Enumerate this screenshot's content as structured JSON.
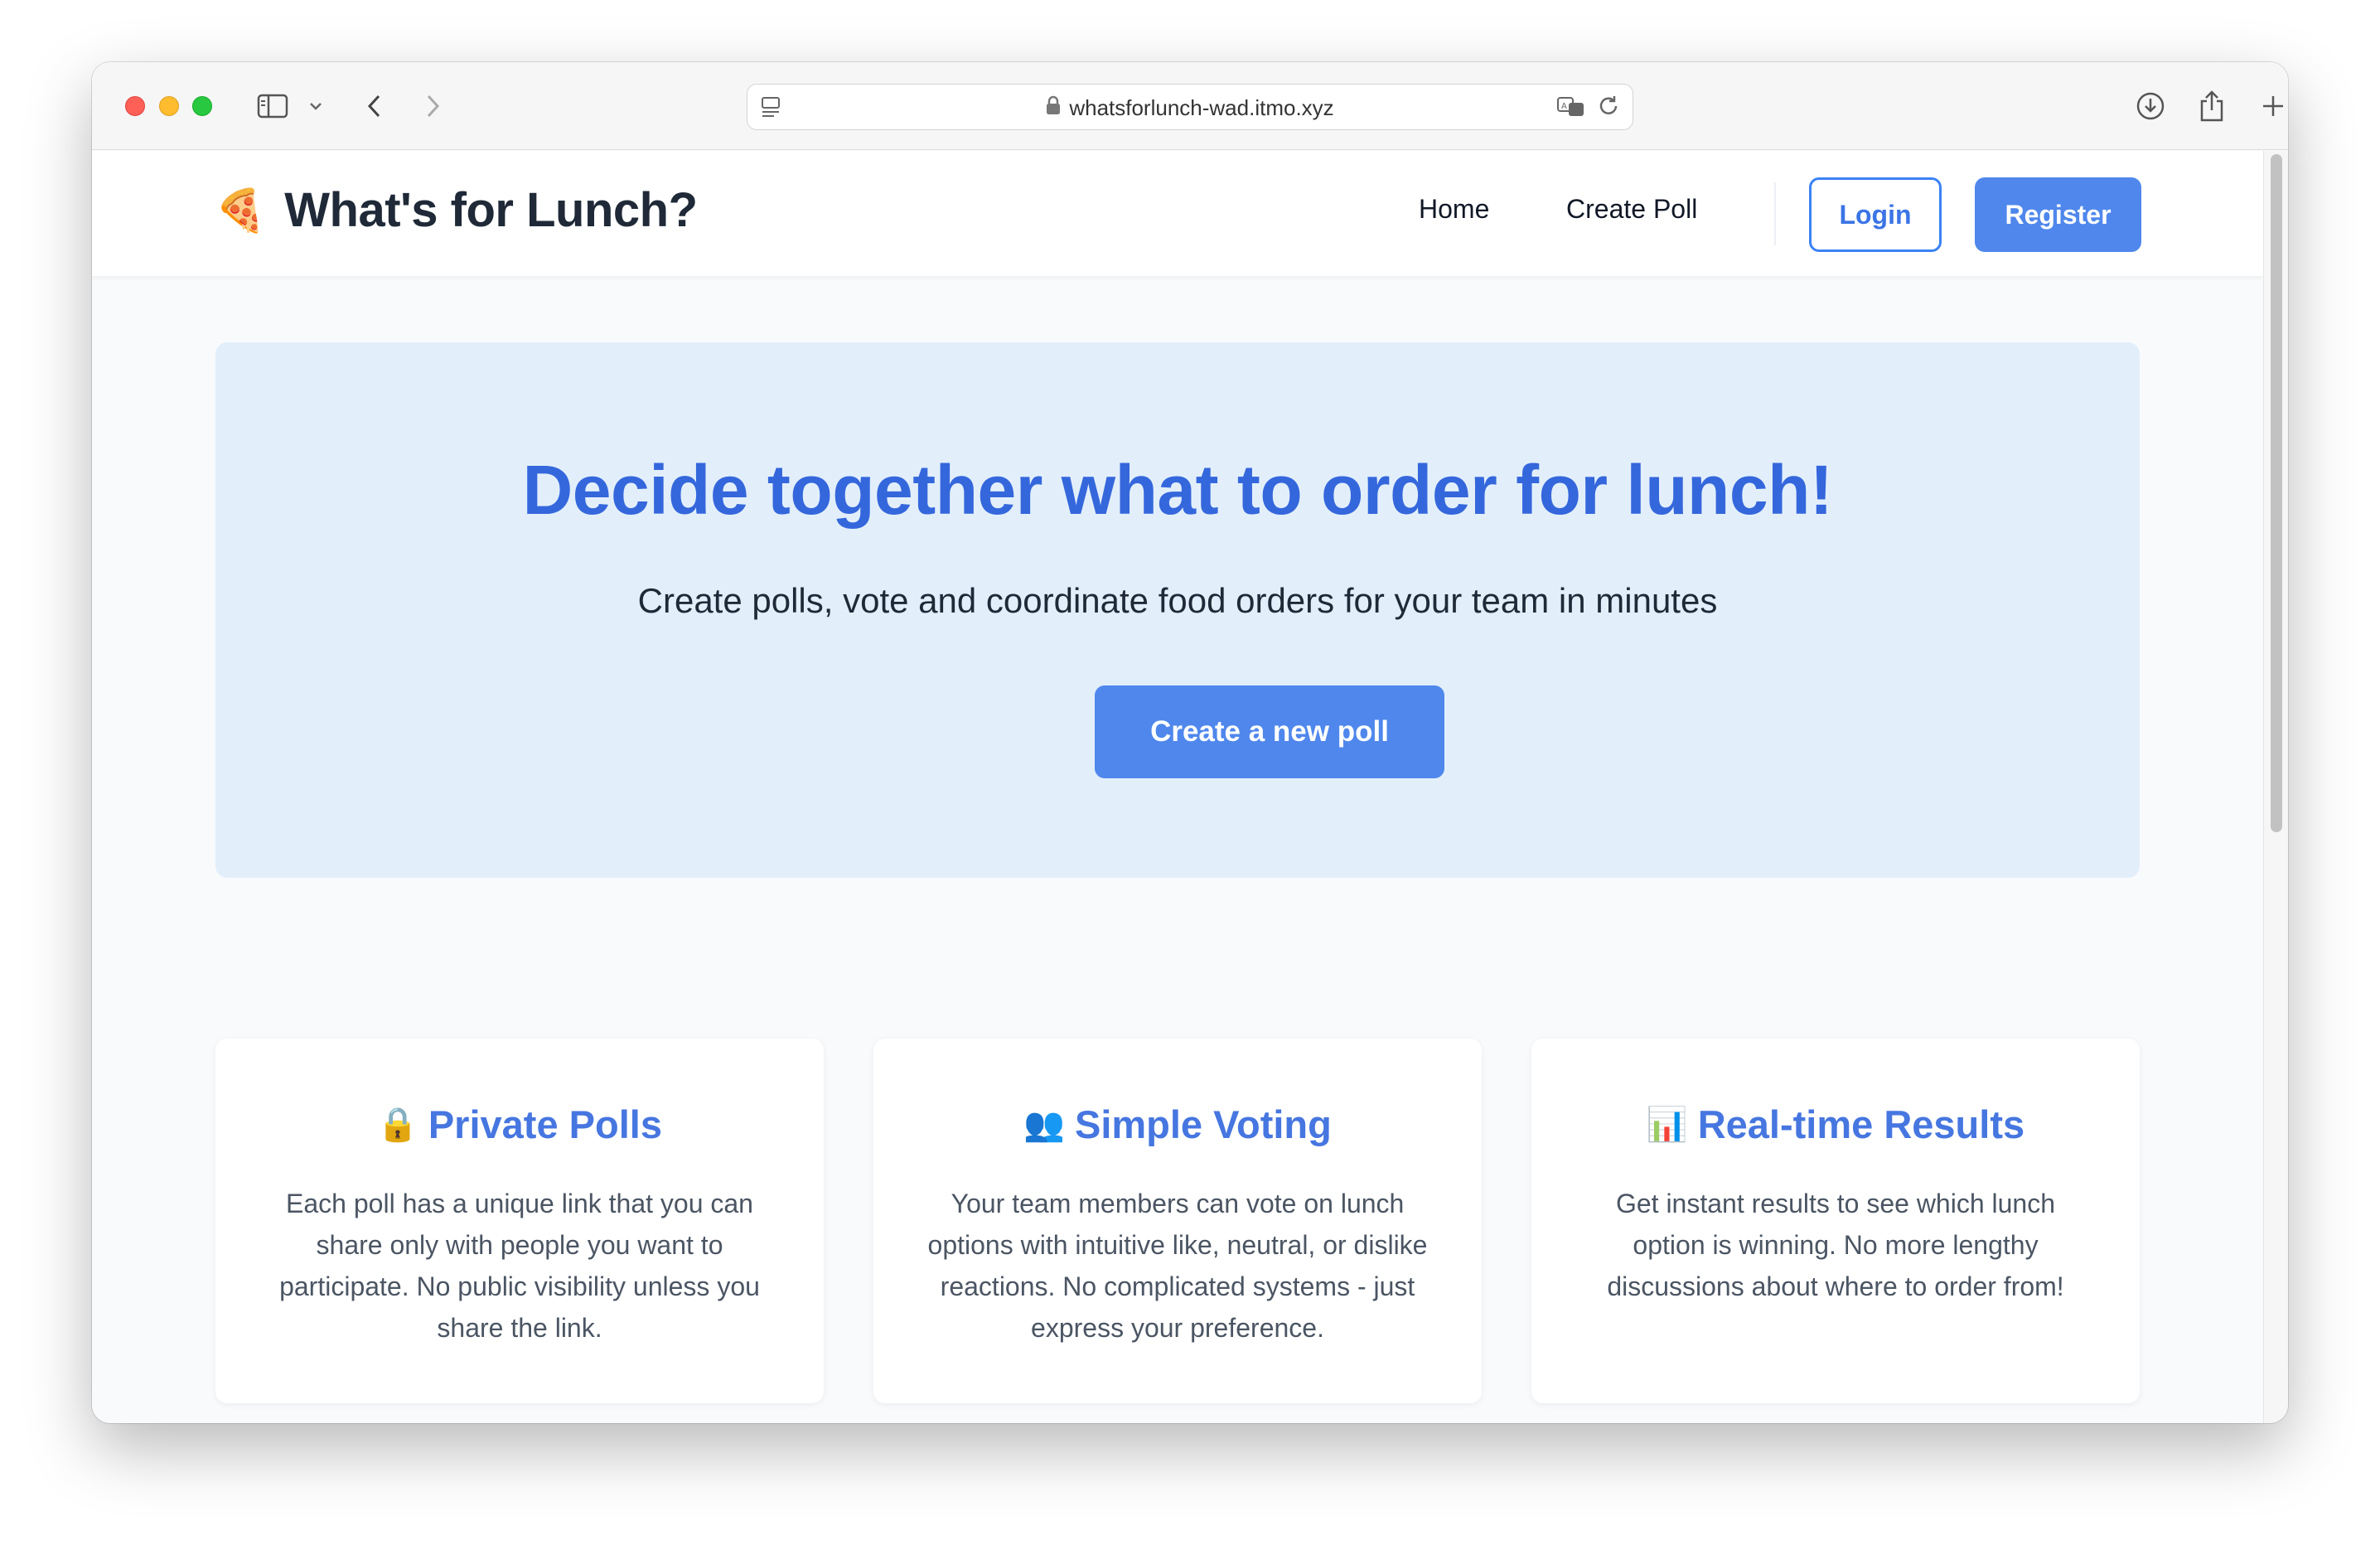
{
  "browser": {
    "url": "whatsforlunch-wad.itmo.xyz"
  },
  "navbar": {
    "brand_emoji": "🍕",
    "brand_title": "What's for Lunch?",
    "links": [
      {
        "label": "Home"
      },
      {
        "label": "Create Poll"
      }
    ],
    "login_label": "Login",
    "register_label": "Register"
  },
  "hero": {
    "title": "Decide together what to order for lunch!",
    "subtitle": "Create polls, vote and coordinate food orders for your team in minutes",
    "cta_label": "Create a new poll"
  },
  "features": [
    {
      "icon": "🔒",
      "title": "Private Polls",
      "text": "Each poll has a unique link that you can share only with people you want to participate. No public visibility unless you share the link."
    },
    {
      "icon": "👥",
      "title": "Simple Voting",
      "text": "Your team members can vote on lunch options with intuitive like, neutral, or dislike reactions. No complicated systems - just express your preference."
    },
    {
      "icon": "📊",
      "title": "Real-time Results",
      "text": "Get instant results to see which lunch option is winning. No more lengthy discussions about where to order from!"
    }
  ],
  "colors": {
    "accent": "#4f87ec",
    "heading_blue": "#3567dc",
    "hero_bg": "#e2effb",
    "page_bg": "#f8fafc"
  }
}
